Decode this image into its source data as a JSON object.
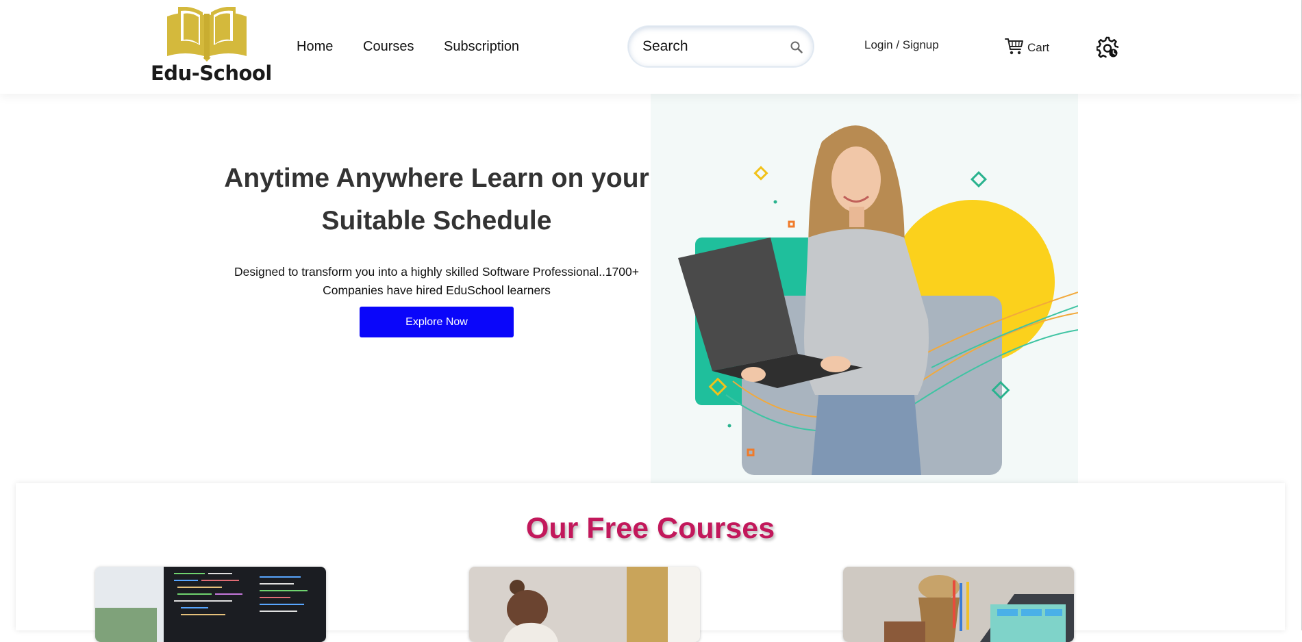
{
  "brand": {
    "name": "Edu-School",
    "logo_color": "#d4b93c"
  },
  "nav": {
    "links": [
      {
        "label": "Home"
      },
      {
        "label": "Courses"
      },
      {
        "label": "Subscription"
      }
    ],
    "search": {
      "placeholder": "Search",
      "icon": "search-icon"
    },
    "login_label": "Login / Signup",
    "cart": {
      "label": "Cart",
      "icon": "cart-icon"
    },
    "settings_icon": "gear-icon"
  },
  "hero": {
    "title": "Anytime Anywhere Learn on your Suitable Schedule",
    "subtitle": "Designed to transform you into a highly skilled Software Professional..1700+ Companies have hired EduSchool learners",
    "cta_label": "Explore Now",
    "cta_color": "#0a06fa",
    "image": "woman-with-laptop-illustration"
  },
  "free_courses": {
    "title": "Our Free Courses",
    "title_color": "#c2185b",
    "cards": [
      {
        "image": "code-on-monitor-photo"
      },
      {
        "image": "woman-studying-photo"
      },
      {
        "image": "laptop-and-pencils-photo"
      }
    ]
  }
}
